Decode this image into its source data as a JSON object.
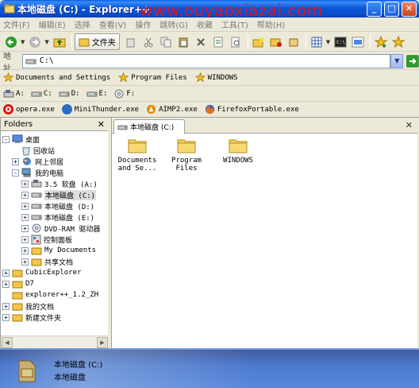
{
  "window": {
    "title": "本地磁盘 (C:) - Explorer++"
  },
  "watermark": "www.ouyaoxiazai.com",
  "menu": [
    "文件(F)",
    "编辑(E)",
    "选择",
    "查看(V)",
    "操作",
    "跳转(G)",
    "收藏",
    "工具(T)",
    "帮助(H)"
  ],
  "toolbar": {
    "folders_label": "文件夹"
  },
  "address": {
    "label": "地址",
    "value": "C:\\"
  },
  "bookmarks": [
    "Documents and Settings",
    "Program Files",
    "WINDOWS"
  ],
  "drives": [
    "A:",
    "C:",
    "D:",
    "E:",
    "F:"
  ],
  "apps": [
    {
      "label": "opera.exe",
      "color": "#D41A1A"
    },
    {
      "label": "MiniThunder.exe",
      "color": "#2B6CC4"
    },
    {
      "label": "AIMP2.exe",
      "color": "#E88A10"
    },
    {
      "label": "FirefoxPortable.exe",
      "color": "#D8601A"
    }
  ],
  "folders_pane": {
    "title": "Folders",
    "tree": [
      {
        "label": "桌面",
        "icon": "desktop",
        "exp": "-"
      },
      {
        "label": "回收站",
        "icon": "recycle",
        "exp": ""
      },
      {
        "label": "网上邻居",
        "icon": "network",
        "exp": "+"
      },
      {
        "label": "我的电脑",
        "icon": "computer",
        "exp": "-"
      },
      {
        "label": "3.5 软盘 (A:)",
        "icon": "floppy",
        "exp": "+"
      },
      {
        "label": "本地磁盘 (C:)",
        "icon": "drive",
        "exp": "+",
        "selected": true
      },
      {
        "label": "本地磁盘 (D:)",
        "icon": "drive",
        "exp": "+"
      },
      {
        "label": "本地磁盘 (E:)",
        "icon": "drive",
        "exp": "+"
      },
      {
        "label": "DVD-RAM 驱动器",
        "icon": "dvd",
        "exp": "+"
      },
      {
        "label": "控制面板",
        "icon": "control",
        "exp": "+"
      },
      {
        "label": "My Documents",
        "icon": "folder",
        "exp": "+"
      },
      {
        "label": "共享文档",
        "icon": "folder",
        "exp": "+"
      },
      {
        "label": "CubicExplorer",
        "icon": "folder",
        "exp": "+"
      },
      {
        "label": "D7",
        "icon": "folder",
        "exp": "+"
      },
      {
        "label": "explorer++_1.2_ZH",
        "icon": "folder",
        "exp": ""
      },
      {
        "label": "我的文档",
        "icon": "folder",
        "exp": "+"
      },
      {
        "label": "新建文件夹",
        "icon": "folder",
        "exp": "+"
      }
    ]
  },
  "tab": {
    "label": "本地磁盘 (C:)"
  },
  "files": [
    {
      "label": "Documents\nand Se..."
    },
    {
      "label": "Program\nFiles"
    },
    {
      "label": "WINDOWS"
    }
  ],
  "status": {
    "title": "本地磁盘 (C:)",
    "subtitle": "本地磁盘"
  }
}
